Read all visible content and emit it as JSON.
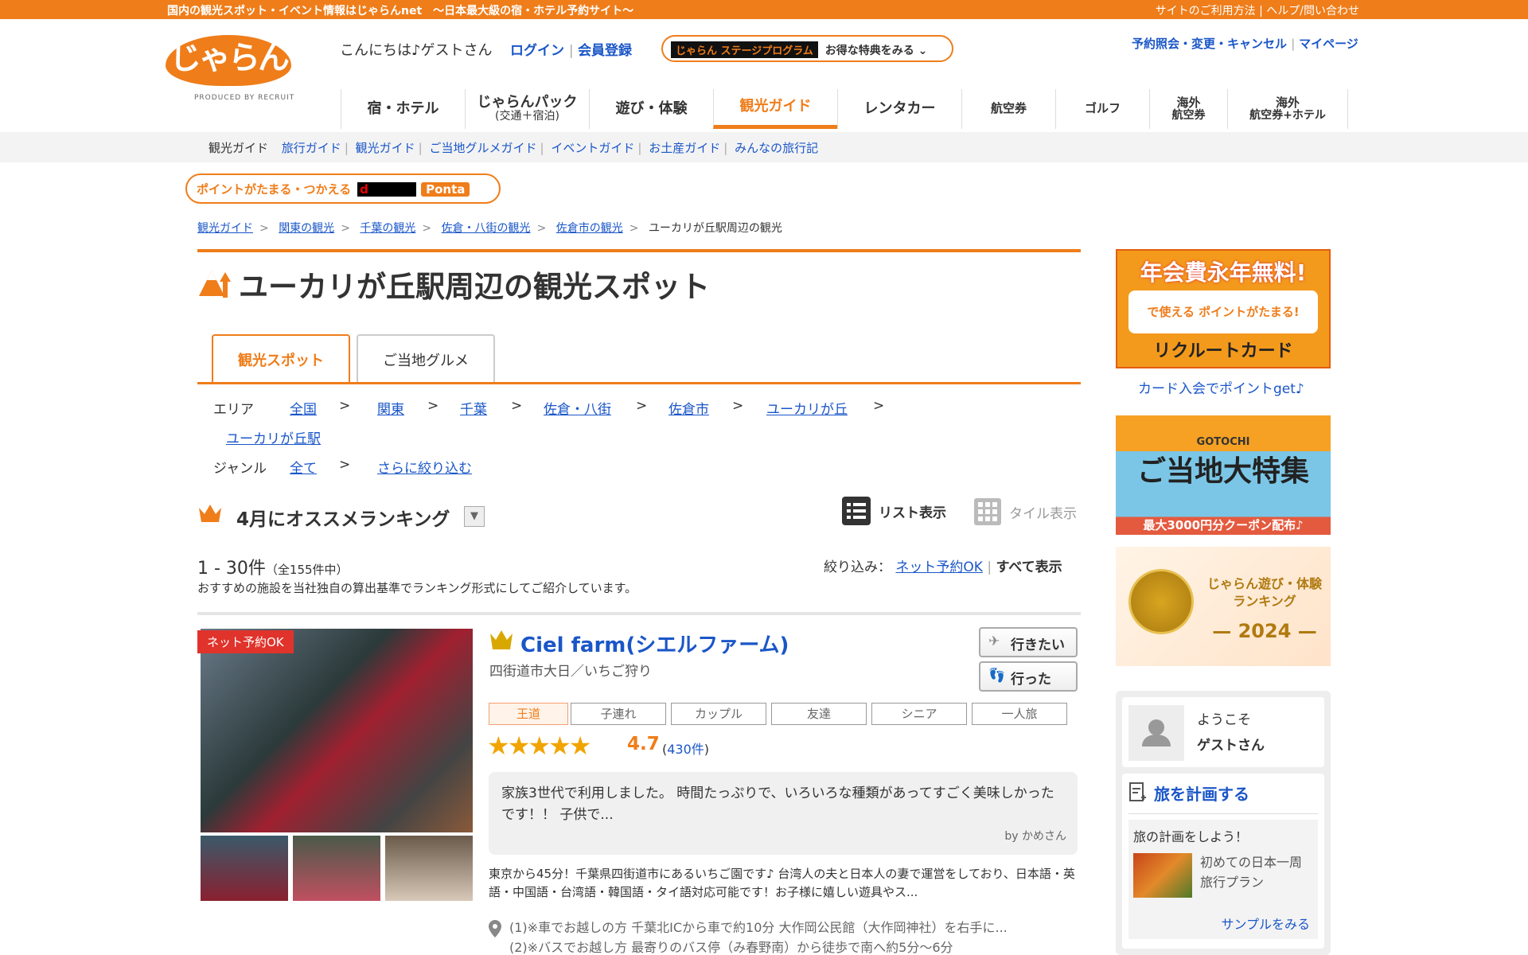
{
  "topbar": {
    "left": "国内の観光スポット・イベント情報はじゃらんnet　～日本最大級の宿・ホテル予約サイト～",
    "right": "サイトのご利用方法 | ヘルプ/問い合わせ"
  },
  "header": {
    "logo": "じゃらん",
    "logo_sub": "PRODUCED BY RECRUIT",
    "greeting": "こんにちは♪ゲストさん",
    "login": "ログイン",
    "register": "会員登録",
    "stage_badge": "じゃらん ステージプログラム",
    "stage_text": "お得な特典をみる",
    "reserve": "予約照会・変更・キャンセル",
    "mypage": "マイページ"
  },
  "gnav": [
    {
      "label": "宿・ホテル"
    },
    {
      "label": "じゃらんパック",
      "sub": "(交通＋宿泊)"
    },
    {
      "label": "遊び・体験"
    },
    {
      "label": "観光ガイド"
    },
    {
      "label": "レンタカー"
    },
    {
      "label": "航空券"
    },
    {
      "label": "ゴルフ"
    },
    {
      "label": "海外",
      "sub": "航空券"
    },
    {
      "label": "海外",
      "sub": "航空券+ホテル"
    }
  ],
  "subnav": {
    "current": "観光ガイド",
    "links": [
      "旅行ガイド",
      "観光ガイド",
      "ご当地グルメガイド",
      "イベントガイド",
      "お土産ガイド",
      "みんなの旅行記"
    ]
  },
  "points": {
    "text": "ポイントがたまる・つかえる",
    "d": "d",
    "ponta": "Ponta"
  },
  "breadcrumb": [
    "観光ガイド",
    "関東の観光",
    "千葉の観光",
    "佐倉・八街の観光",
    "佐倉市の観光",
    "ユーカリが丘駅周辺の観光"
  ],
  "page_title": "ユーカリが丘駅周辺の観光スポット",
  "tabs": [
    "観光スポット",
    "ご当地グルメ"
  ],
  "area": {
    "label": "エリア",
    "items": [
      "全国",
      "関東",
      "千葉",
      "佐倉・八街",
      "佐倉市",
      "ユーカリが丘"
    ],
    "last": "ユーカリが丘駅",
    "sep": ">"
  },
  "genre": {
    "label": "ジャンル",
    "all": "全て",
    "more": "さらに絞り込む"
  },
  "ranking": {
    "title": "4月にオススメランキング",
    "dropdown": "▼"
  },
  "view": {
    "list": "リスト表示",
    "tile": "タイル表示"
  },
  "results": {
    "range": "1 - 30件",
    "total": "（全155件中）",
    "desc": "おすすめの施設を当社独自の算出基準でランキング形式にしてご紹介しています。"
  },
  "filter": {
    "label": "絞り込み：",
    "netok": "ネット予約OK",
    "all": "すべて表示"
  },
  "spot": {
    "badge": "ネット予約OK",
    "name": "Ciel farm(シエルファーム)",
    "sub": "四街道市大日／いちご狩り",
    "want": "行きたい",
    "went": "行った",
    "tags": [
      "王道",
      "子連れ",
      "カップル",
      "友達",
      "シニア",
      "一人旅"
    ],
    "stars": "★★★★★",
    "rating": "4.7",
    "reviews_pre": "(",
    "reviews": "430件",
    "reviews_post": ")",
    "review": "家族3世代で利用しました。 時間たっぷりで、いろいろな種類があってすごく美味しかったです！！ 子供で...",
    "review_by": "by かめさん",
    "body": "東京から45分！千葉県四街道市にあるいちご園です♪ 台湾人の夫と日本人の妻で運営をしており、日本語・英語・中国語・台湾語・韓国語・タイ語対応可能です！お子様に嬉しい遊具やス...",
    "access1": "(1)※車でお越しの方 千葉北ICから車で約10分 大作岡公民館（大作岡神社）を右手に...",
    "access2": "(2)※バスでお越し方 最寄りのバス停（み春野南）から徒歩で南へ約5分～6分"
  },
  "sidebar": {
    "bnr1_title": "年会費永年無料!",
    "bnr1_mid": "で使える ポイントがたまる!",
    "bnr1_foot": "リクルートカード",
    "bnr1_link": "カード入会でポイントget♪",
    "bnr2_top": "GOTOCHI",
    "bnr2_title": "ご当地大特集",
    "bnr2_foot": "最大3000円分クーポン配布♪",
    "bnr3_title": "じゃらん遊び・体験 ランキング",
    "bnr3_year": "— 2024 —",
    "welcome": "ようこそ",
    "guest": "ゲストさん",
    "plan_title": "旅を計画する",
    "plan_lead": "旅の計画をしよう！",
    "plan_item1": "初めての日本一周",
    "plan_item2": "旅行プラン",
    "plan_sample": "サンプルをみる"
  },
  "colors": {
    "accent": "#ef7d1a",
    "link": "#1a56c8",
    "star": "#f1a400",
    "red": "#e0332b"
  }
}
